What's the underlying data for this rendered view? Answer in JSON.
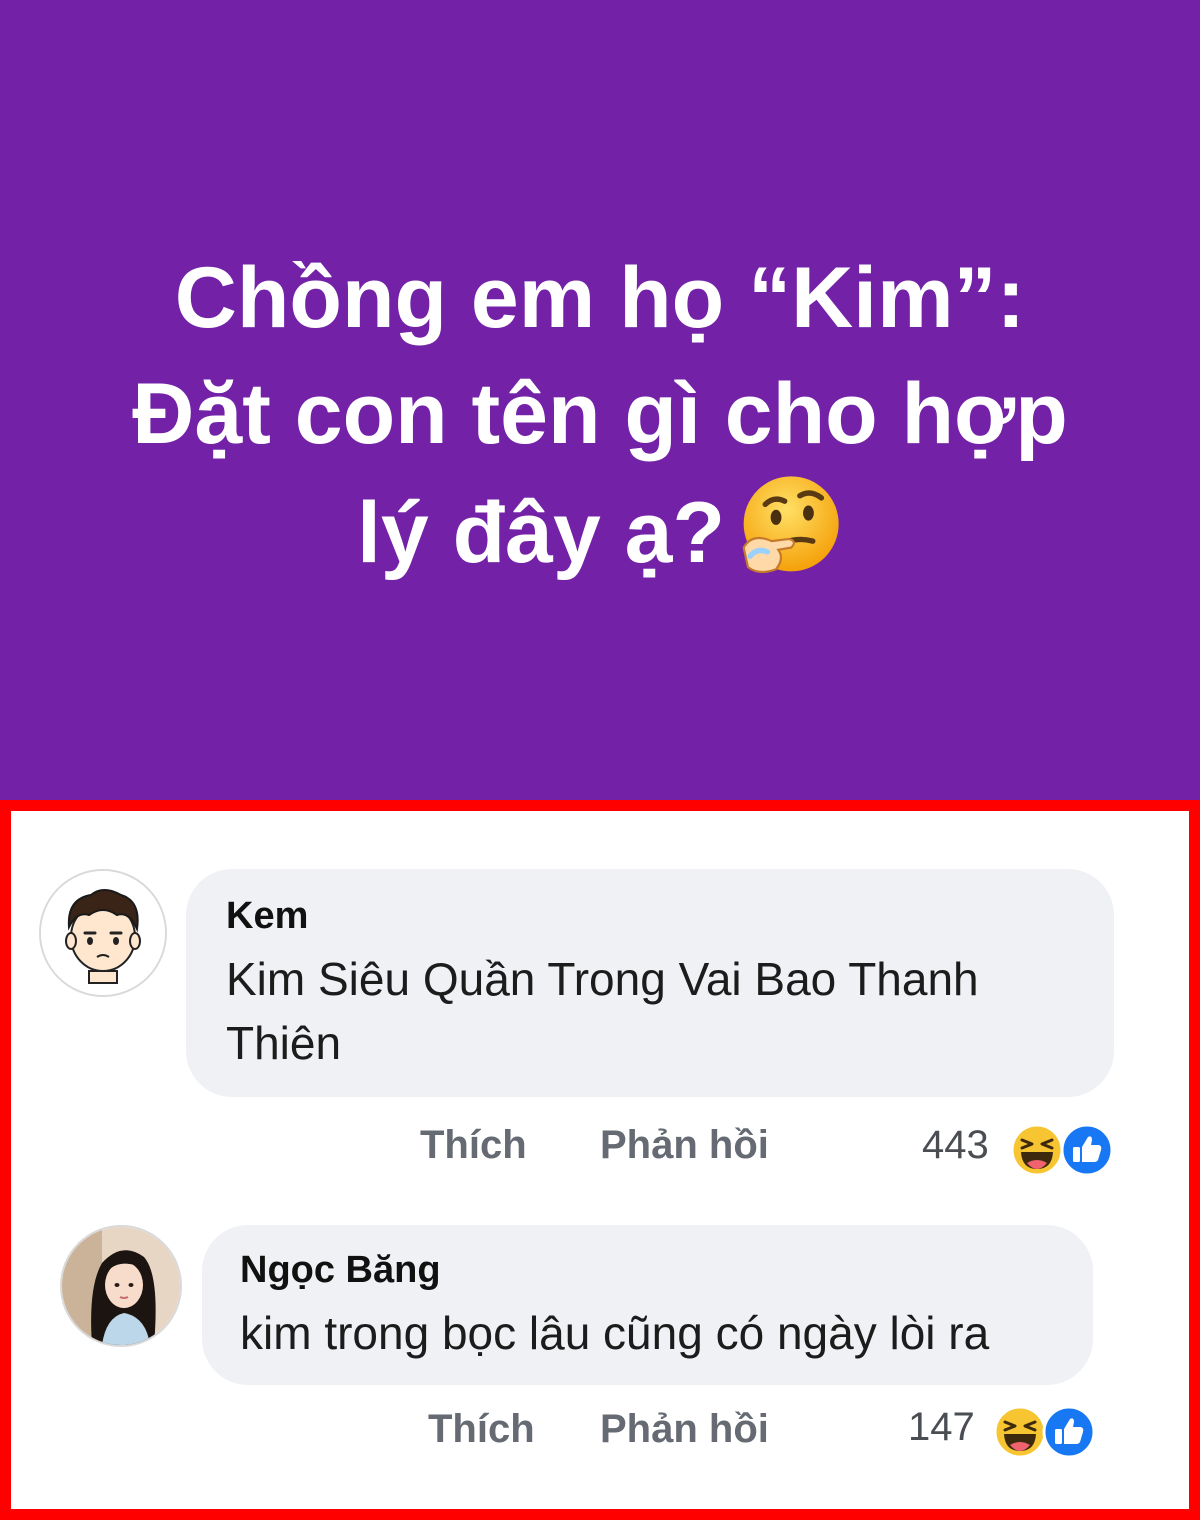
{
  "post": {
    "background_color": "#7322a8",
    "text_lines": [
      "Chồng em họ “Kim”:",
      "Đặt con tên gì cho hợp",
      "lý đây ạ?"
    ],
    "emoji": "thinking-face-icon"
  },
  "comments": [
    {
      "author": "Kem",
      "text": "Kim Siêu Quần Trong Vai Bao Thanh Thiên",
      "like_label": "Thích",
      "reply_label": "Phản hồi",
      "reaction_count": "443",
      "reactions": [
        "haha-reaction-icon",
        "like-reaction-icon"
      ]
    },
    {
      "author": "Ngọc Băng",
      "text": "kim trong bọc lâu cũng có ngày lòi ra",
      "like_label": "Thích",
      "reply_label": "Phản hồi",
      "reaction_count": "147",
      "reactions": [
        "haha-reaction-icon",
        "like-reaction-icon"
      ]
    }
  ],
  "colors": {
    "highlight_border": "#ff0000",
    "bubble": "#eff1f4",
    "like_blue": "#1877f2"
  }
}
